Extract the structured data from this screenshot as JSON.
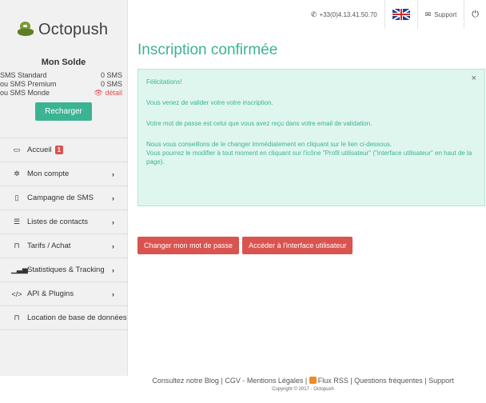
{
  "topbar": {
    "phone": "+33(0)4.13.41.50.70",
    "support_label": "Support"
  },
  "sidebar": {
    "logo_text": "Octopush",
    "balance": {
      "title": "Mon Solde",
      "rows": [
        {
          "label": "SMS Standard",
          "value": "0 SMS"
        },
        {
          "label": "ou SMS Premium",
          "value": "0 SMS"
        },
        {
          "label": "ou SMS Monde",
          "value": "détail"
        }
      ],
      "recharge_label": "Recharger"
    },
    "menu": [
      {
        "label": "Accueil",
        "badge": "1"
      },
      {
        "label": "Mon compte"
      },
      {
        "label": "Campagne de SMS"
      },
      {
        "label": "Listes de contacts"
      },
      {
        "label": "Tarifs / Achat"
      },
      {
        "label": "Statistiques & Tracking"
      },
      {
        "label": "API & Plugins"
      },
      {
        "label": "Location de base de données"
      }
    ]
  },
  "main": {
    "title": "Inscription confirmée",
    "alert": {
      "heading": "Félicitations!",
      "p1": "Vous venez de valider votre votre inscription.",
      "p2": "Votre mot de passe est celui que vous avez reçu dans votre email de validation.",
      "p3a": "Nous vous conseillons de le changer immédiatement en cliquant sur le lien ci-dessous.",
      "p3b": "Vous pourrez le modifier à tout moment en cliquant sur l'icône \"Profil utilisateur\" (\"interface utilisateur\" en haut de la page).",
      "close": "×"
    },
    "buttons": {
      "change_password": "Changer mon mot de passe",
      "user_interface": "Accéder à l'interface utilisateur"
    }
  },
  "footer": {
    "blog": "Consultez notre Blog",
    "cgv": "CGV - Mentions Légales",
    "rss": "Flux RSS",
    "faq": "Questions fréquentes",
    "support": "Support",
    "sep": "|",
    "copyright": "Copyright © 2017 - Octopush"
  },
  "colors": {
    "accent": "#3cb393",
    "danger": "#d9534f",
    "alert_bg": "#dff6ef"
  }
}
